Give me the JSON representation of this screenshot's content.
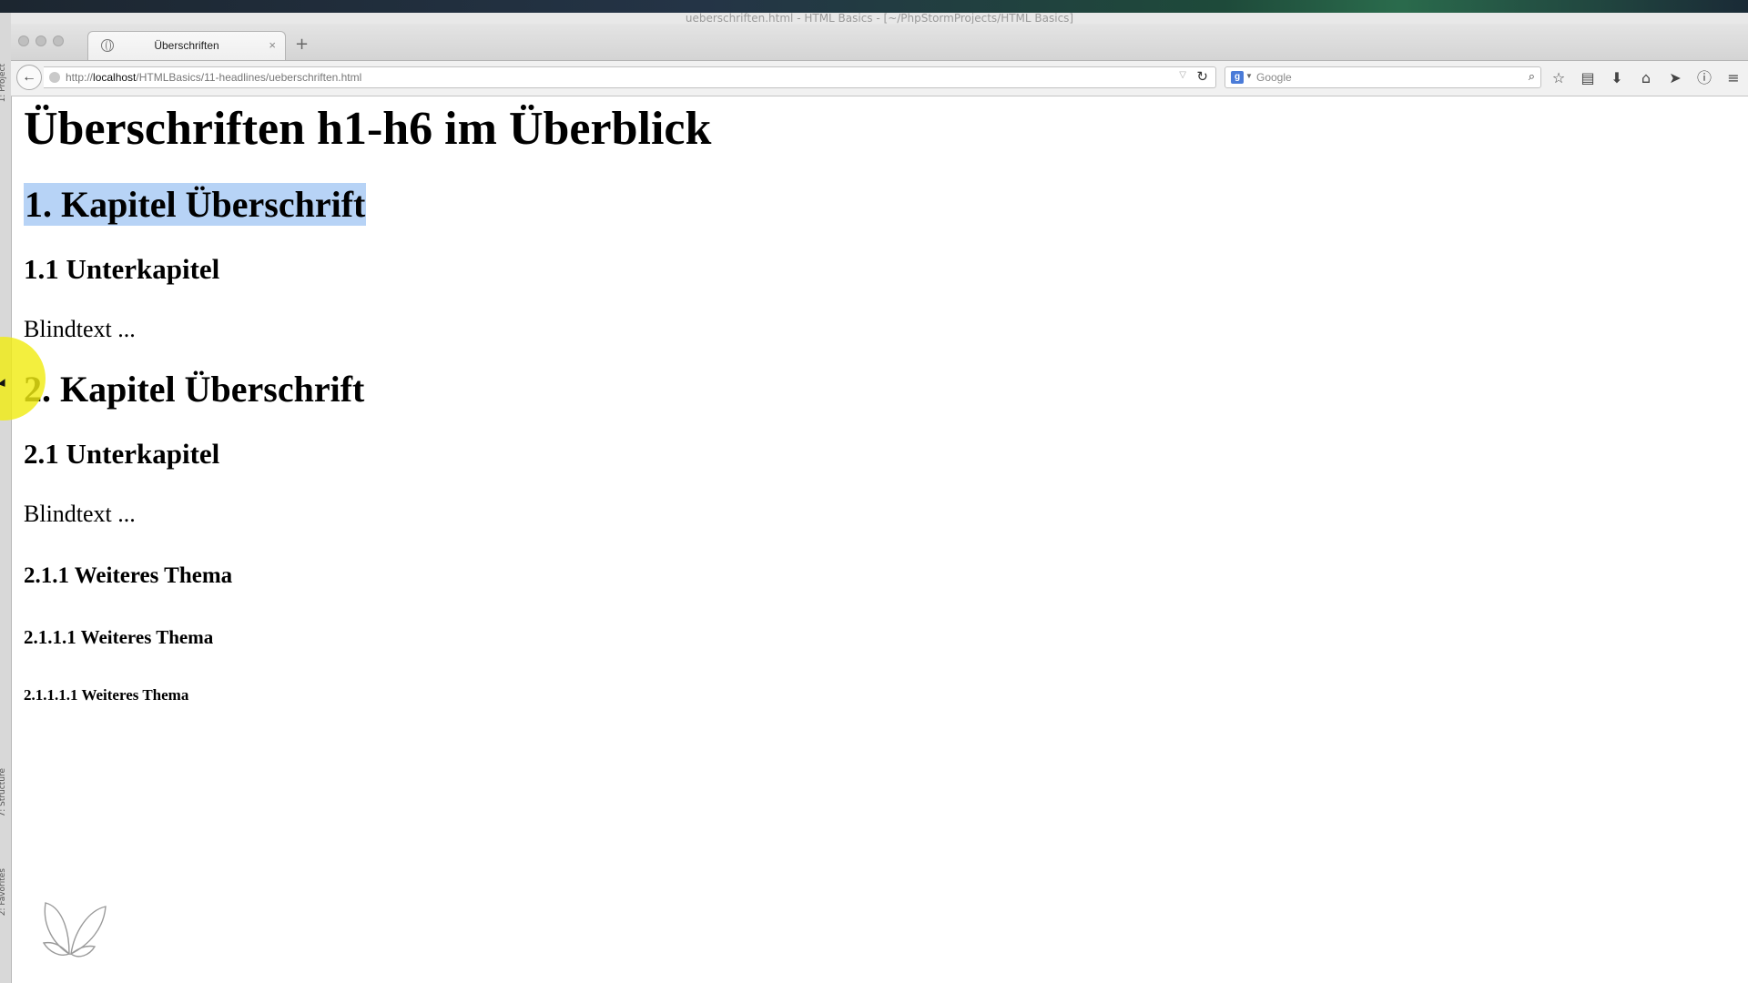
{
  "window": {
    "title": "ueberschriften.html - HTML Basics - [~/PhpStormProjects/HTML Basics]"
  },
  "ide": {
    "rail_labels": [
      "1: Project",
      "7: Structure",
      "2: Favorites"
    ]
  },
  "browser": {
    "tab": {
      "title": "Überschriften",
      "close": "×"
    },
    "new_tab": "+",
    "url": {
      "prefix": "http://",
      "host": "localhost",
      "path": "/HTMLBasics/11-headlines/ueberschriften.html"
    },
    "search": {
      "engine_badge": "g",
      "placeholder": "Google"
    },
    "toolbar_icons": [
      "star-icon",
      "reading-list-icon",
      "download-icon",
      "home-icon",
      "send-icon",
      "info-icon",
      "menu-icon"
    ]
  },
  "page": {
    "h1_main": "Überschriften h1-h6 im Überblick",
    "chapter1": "1. Kapitel Überschrift",
    "sub1_1": "1.1 Unterkapitel",
    "text1": "Blindtext ...",
    "chapter2": "2. Kapitel Überschrift",
    "sub2_1": "2.1 Unterkapitel",
    "text2": "Blindtext ...",
    "h3": "2.1.1 Weiteres Thema",
    "h4": "2.1.1.1 Weiteres Thema",
    "h5": "2.1.1.1.1 Weiteres Thema"
  },
  "colors": {
    "selection": "#b7d3f6",
    "cursor_highlight": "#f0ec14"
  }
}
